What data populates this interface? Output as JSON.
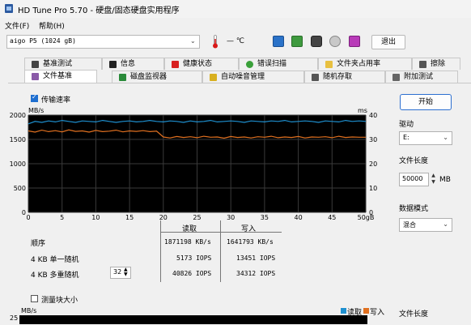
{
  "window": {
    "title": "HD Tune Pro 5.70 - 硬盘/固态硬盘实用程序"
  },
  "menu": {
    "file": "文件(F)",
    "help": "帮助(H)"
  },
  "toolbar": {
    "drive": "aigo    P5 (1024 gB)",
    "temperature": "— ℃",
    "exit_label": "退出"
  },
  "tabs_row1": [
    "基准测试",
    "信息",
    "健康状态",
    "错误扫描",
    "文件夹占用率",
    "擦除"
  ],
  "tabs_row2": [
    "文件基准",
    "磁盘监视器",
    "自动噪音管理",
    "随机存取",
    "附加测试"
  ],
  "transfer": {
    "checkbox_label": "传输速率",
    "checked": true,
    "y_unit_left": "MB/s",
    "y_unit_right": "ms",
    "x_ticks": [
      "0",
      "5",
      "10",
      "15",
      "20",
      "25",
      "30",
      "35",
      "40",
      "45",
      "50gB"
    ]
  },
  "chart_data": {
    "type": "line",
    "xlabel": "",
    "x_range": [
      0,
      50
    ],
    "y_left": {
      "label": "MB/s",
      "ticks": [
        0,
        500,
        1000,
        1500,
        2000
      ],
      "range": [
        0,
        2000
      ]
    },
    "y_right": {
      "label": "ms",
      "ticks": [
        0,
        10,
        20,
        30,
        40
      ],
      "range": [
        0,
        40
      ]
    },
    "grid": true,
    "x": [
      0,
      1,
      2,
      3,
      4,
      5,
      6,
      7,
      8,
      9,
      10,
      11,
      12,
      13,
      14,
      15,
      16,
      17,
      18,
      19,
      20,
      21,
      22,
      23,
      24,
      25,
      26,
      27,
      28,
      29,
      30,
      31,
      32,
      33,
      34,
      35,
      36,
      37,
      38,
      39,
      40,
      41,
      42,
      43,
      44,
      45,
      46,
      47,
      48,
      49,
      50
    ],
    "series": [
      {
        "axis": "left",
        "color": "#1e90d0",
        "values": [
          1820,
          1870,
          1850,
          1880,
          1860,
          1890,
          1870,
          1850,
          1880,
          1870,
          1860,
          1890,
          1870,
          1850,
          1870,
          1880,
          1860,
          1870,
          1890,
          1870,
          1860,
          1880,
          1870,
          1850,
          1880,
          1860,
          1870,
          1890,
          1860,
          1870,
          1880,
          1870,
          1850,
          1880,
          1870,
          1860,
          1880,
          1870,
          1890,
          1860,
          1870,
          1880,
          1870,
          1850,
          1880,
          1870,
          1860,
          1890,
          1870,
          1880,
          1870
        ]
      },
      {
        "axis": "right",
        "color": "#e07020",
        "values": [
          33.5,
          33,
          33.8,
          33.2,
          33.6,
          33.1,
          33.9,
          33.3,
          33.5,
          33,
          33.7,
          33.2,
          33.4,
          33.8,
          33.1,
          33.5,
          33.3,
          33.6,
          33.2,
          33.4,
          31,
          30.6,
          31.2,
          30.8,
          31.1,
          30.7,
          31.3,
          30.9,
          31,
          30.5,
          31.2,
          30.8,
          31,
          30.6,
          31.1,
          30.9,
          31.3,
          30.7,
          31,
          30.8,
          31.2,
          30.6,
          31,
          30.9,
          31.1,
          30.7,
          31.3,
          30.8,
          31,
          30.9,
          30.9
        ]
      }
    ]
  },
  "results": {
    "col_read": "读取",
    "col_write": "写入",
    "rows": [
      {
        "label": "顺序",
        "read": "1871198 KB/s",
        "write": "1641793 KB/s"
      },
      {
        "label": "4 KB 单一随机",
        "read": "5173 IOPS",
        "write": "13451 IOPS"
      },
      {
        "label": "4 KB 多重随机",
        "read": "40826 IOPS",
        "write": "34312 IOPS"
      }
    ],
    "queue_depth": "32"
  },
  "block_size": {
    "checkbox_label": "测量块大小",
    "checked": false,
    "y_unit": "MB/s",
    "y_top": "25",
    "legend_read": "读取",
    "legend_write": "写入"
  },
  "side": {
    "start_label": "开始",
    "drive_label": "驱动",
    "drive_value": "E:",
    "file_length_label": "文件长度",
    "file_length_value": "50000",
    "file_length_unit": "MB",
    "data_pattern_label": "数据模式",
    "data_pattern_value": "混合",
    "file_length_label2": "文件长度"
  },
  "colors": {
    "chart_bg": "#000000",
    "grid": "#3a3a3a",
    "read": "#1e90d0",
    "write": "#e07020",
    "accent": "#2c6fd0"
  }
}
